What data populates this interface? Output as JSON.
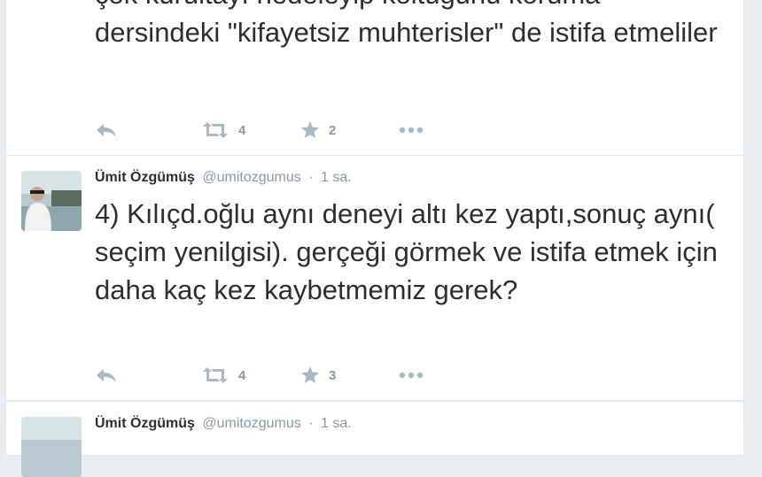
{
  "colors": {
    "text": "#292f33",
    "secondary": "#8899a6",
    "icon": "#aab8c2",
    "border": "#e1e8ed"
  },
  "tweets": [
    {
      "text": "çok kurultayı nedeleyip koltuğunu koruma dersindeki \"kifayetsiz muhterisler\" de istifa etmeliler",
      "actions": {
        "reply_icon": "reply-icon",
        "retweet_icon": "retweet-icon",
        "retweet_count": "4",
        "favorite_icon": "star-icon",
        "favorite_count": "2",
        "more_icon": "more-dots-icon"
      }
    },
    {
      "fullname": "Ümit Özgümüş",
      "username": "@umitozgumus",
      "separator": "·",
      "time": "1 sa.",
      "text": "4) Kılıçd.oğlu aynı deneyi altı kez yaptı,sonuç aynı( seçim yenilgisi). gerçeği görmek ve istifa etmek için daha kaç kez kaybetmemiz gerek?",
      "actions": {
        "reply_icon": "reply-icon",
        "retweet_icon": "retweet-icon",
        "retweet_count": "4",
        "favorite_icon": "star-icon",
        "favorite_count": "3",
        "more_icon": "more-dots-icon"
      }
    },
    {
      "fullname": "Ümit Özgümüş",
      "username": "@umitozgumus",
      "separator": "·",
      "time": "1 sa."
    }
  ]
}
